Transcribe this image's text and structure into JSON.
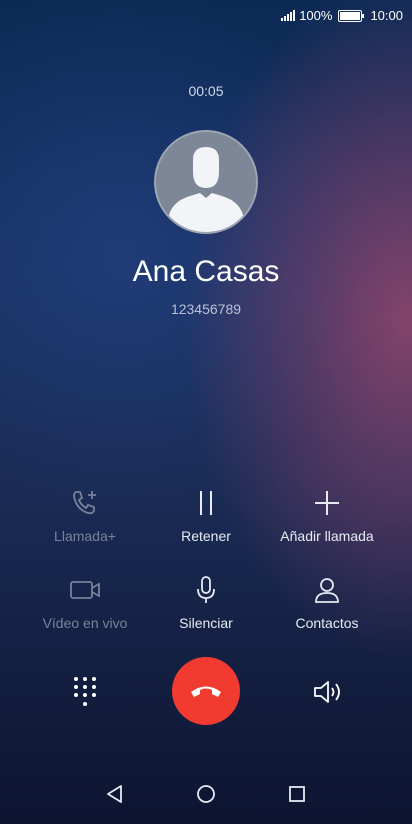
{
  "status": {
    "battery": "100%",
    "time": "10:00",
    "battery_level": 1.0
  },
  "call": {
    "timer": "00:05",
    "name": "Ana Casas",
    "number": "123456789"
  },
  "actions": [
    {
      "label": "Llamada+",
      "icon": "add-call-icon",
      "enabled": false
    },
    {
      "label": "Retener",
      "icon": "hold-icon",
      "enabled": true
    },
    {
      "label": "Añadir llamada",
      "icon": "plus-icon",
      "enabled": true
    },
    {
      "label": "Vídeo en vivo",
      "icon": "video-icon",
      "enabled": false
    },
    {
      "label": "Silenciar",
      "icon": "microphone-icon",
      "enabled": true
    },
    {
      "label": "Contactos",
      "icon": "contact-icon",
      "enabled": true
    }
  ],
  "controls": {
    "keypad_icon": "dialpad-icon",
    "end_icon": "end-call-icon",
    "speaker_icon": "speaker-icon"
  },
  "nav": {
    "back": "back-icon",
    "home": "home-icon",
    "recents": "recents-icon"
  },
  "colors": {
    "end_call": "#f13a30",
    "disabled": "#77829a"
  }
}
